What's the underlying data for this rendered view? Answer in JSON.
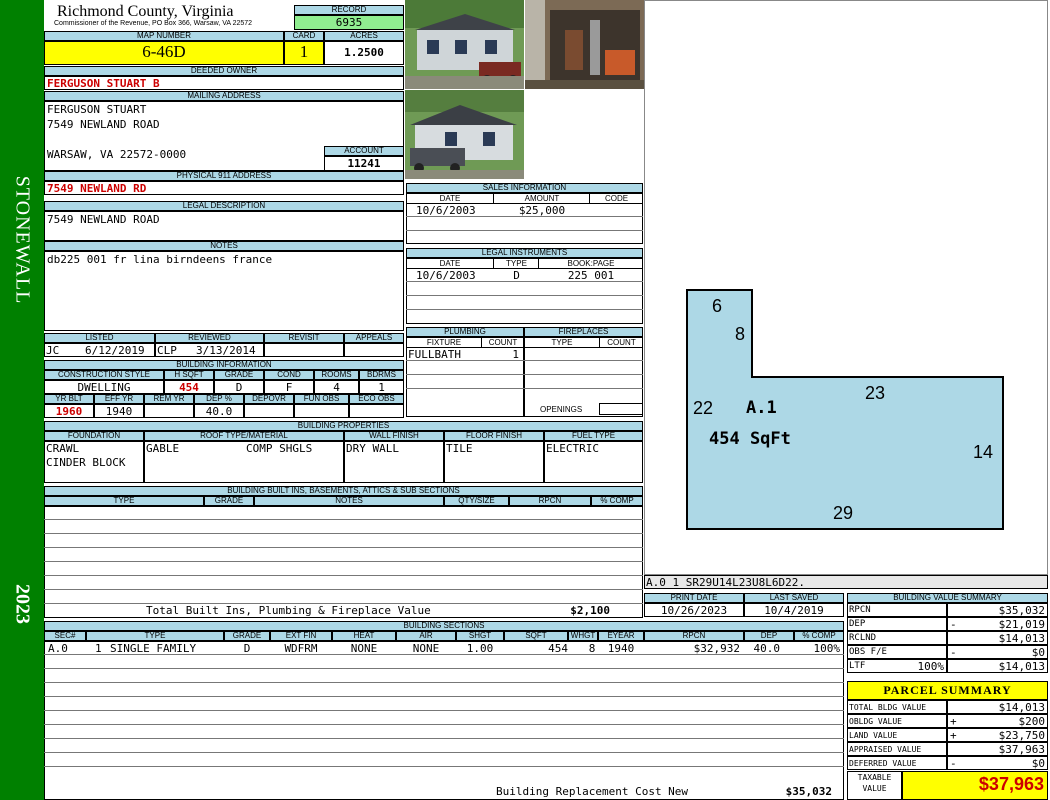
{
  "side": {
    "district": "STONEWALL",
    "year": "2023"
  },
  "header": {
    "county": "Richmond County, Virginia",
    "office": "Commissioner of the Revenue, PO Box 366, Warsaw, VA 22572",
    "record_label": "RECORD",
    "record": "6935",
    "map_label": "MAP NUMBER",
    "map": "6-46D",
    "card_label": "CARD",
    "card": "1",
    "acres_label": "ACRES",
    "acres": "1.2500"
  },
  "owner": {
    "deeded_label": "DEEDED OWNER",
    "deeded": "FERGUSON STUART B",
    "mailing_label": "MAILING ADDRESS",
    "mail1": "FERGUSON STUART",
    "mail2": "7549 NEWLAND ROAD",
    "mail3": "WARSAW, VA 22572-0000",
    "account_label": "ACCOUNT",
    "account": "11241",
    "physical_label": "PHYSICAL 911 ADDRESS",
    "physical": "7549 NEWLAND RD",
    "legal_label": "LEGAL DESCRIPTION",
    "legal": "7549 NEWLAND ROAD",
    "notes_label": "NOTES",
    "notes": "db225 001 fr lina birndeens france"
  },
  "sales": {
    "title": "SALES INFORMATION",
    "cols": [
      "DATE",
      "AMOUNT",
      "CODE"
    ],
    "row": {
      "date": "10/6/2003",
      "amount": "$25,000",
      "code": ""
    }
  },
  "instruments": {
    "title": "LEGAL INSTRUMENTS",
    "cols": [
      "DATE",
      "TYPE",
      "BOOK:PAGE"
    ],
    "row": {
      "date": "10/6/2003",
      "type": "D",
      "book": "225 001"
    }
  },
  "dates": {
    "listed_label": "LISTED",
    "listed_by": "JC",
    "listed": "6/12/2019",
    "reviewed_label": "REVIEWED",
    "reviewed_by": "CLP",
    "reviewed": "3/13/2014",
    "revisit_label": "REVISIT",
    "appeals_label": "APPEALS"
  },
  "building": {
    "title": "BUILDING INFORMATION",
    "cols1": [
      "CONSTRUCTION STYLE",
      "H SQFT",
      "GRADE",
      "COND",
      "ROOMS",
      "BDRMS"
    ],
    "style": "DWELLING",
    "hsqft": "454",
    "grade": "D",
    "cond": "F",
    "rooms": "4",
    "bdrms": "1",
    "cols2": [
      "YR BLT",
      "EFF YR",
      "REM YR",
      "DEP %",
      "DEPOVR",
      "FUN OBS",
      "ECO OBS"
    ],
    "yrblt": "1960",
    "effyr": "1940",
    "remyr": "",
    "dep": "40.0"
  },
  "plumbing": {
    "title": "PLUMBING",
    "cols": [
      "FIXTURE",
      "COUNT"
    ],
    "fixture": "FULLBATH",
    "count": "1"
  },
  "fireplaces": {
    "title": "FIREPLACES",
    "cols": [
      "TYPE",
      "COUNT"
    ],
    "openings": "OPENINGS"
  },
  "properties": {
    "title": "BUILDING PROPERTIES",
    "cols": [
      "FOUNDATION",
      "ROOF TYPE/MATERIAL",
      "WALL FINISH",
      "FLOOR FINISH",
      "FUEL TYPE"
    ],
    "foundation1": "CRAWL",
    "foundation2": "CINDER BLOCK",
    "roof_type": "GABLE",
    "roof_material": "COMP SHGLS",
    "wall": "DRY WALL",
    "floor": "TILE",
    "fuel": "ELECTRIC"
  },
  "builtins": {
    "title": "BUILDING BUILT INS, BASEMENTS, ATTICS & SUB SECTIONS",
    "cols": [
      "TYPE",
      "GRADE",
      "NOTES",
      "QTY/SIZE",
      "RPCN",
      "% COMP"
    ],
    "total_label": "Total Built Ins, Plumbing & Fireplace Value",
    "total": "$2,100"
  },
  "sketch": {
    "labels": [
      "6",
      "8",
      "23",
      "22",
      "14",
      "29"
    ],
    "section": "A.1",
    "area": "454 SqFt",
    "code": "A.0   1    SR29U14L23U8L6D22."
  },
  "print": {
    "print_label": "PRINT DATE",
    "print": "10/26/2023",
    "saved_label": "LAST SAVED",
    "saved": "10/4/2019"
  },
  "sections": {
    "title": "BUILDING SECTIONS",
    "cols": [
      "SEC#",
      "TYPE",
      "GRADE",
      "EXT FIN",
      "HEAT",
      "AIR",
      "SHGT",
      "SQFT",
      "WHGT",
      "EYEAR",
      "RPCN",
      "DEP",
      "% COMP"
    ],
    "row": {
      "sec": "A.0",
      "num": "1",
      "type": "SINGLE FAMILY",
      "grade": "D",
      "ext": "WDFRM",
      "heat": "NONE",
      "air": "NONE",
      "shgt": "1.00",
      "sqft": "454",
      "whgt": "8",
      "eyear": "1940",
      "rpcn": "$32,932",
      "dep": "40.0",
      "comp": "100%"
    },
    "brcn_label": "Building Replacement Cost New",
    "brcn": "$35,032"
  },
  "value_summary": {
    "title": "BUILDING VALUE SUMMARY",
    "rpcn_label": "RPCN",
    "rpcn": "$35,032",
    "dep_label": "DEP",
    "dep_sign": "-",
    "dep": "$21,019",
    "rclnd_label": "RCLND",
    "rclnd": "$14,013",
    "obs_label": "OBS F/E",
    "obs_sign": "-",
    "obs": "$0",
    "ltf_label": "LTF",
    "ltf_pct": "100%",
    "ltf": "$14,013"
  },
  "parcel": {
    "title": "PARCEL SUMMARY",
    "bldg_label": "TOTAL BLDG VALUE",
    "bldg": "$14,013",
    "obldg_label": "OBLDG VALUE",
    "obldg_sign": "+",
    "obldg": "$200",
    "land_label": "LAND VALUE",
    "land_sign": "+",
    "land": "$23,750",
    "appr_label": "APPRAISED VALUE",
    "appr": "$37,963",
    "def_label": "DEFERRED VALUE",
    "def_sign": "-",
    "def": "$0",
    "taxable_label1": "TAXABLE",
    "taxable_label2": "VALUE",
    "taxable": "$37,963"
  },
  "colors": {
    "header": "#add8e6",
    "highlight": "#ffff00",
    "side": "#008000",
    "record": "#90ee90",
    "alert": "#cc0000"
  }
}
